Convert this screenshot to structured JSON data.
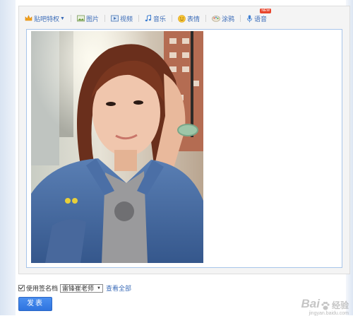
{
  "toolbar": {
    "items": [
      {
        "label": "贴吧特权",
        "icon": "crown-icon",
        "dropdown": true
      },
      {
        "label": "图片",
        "icon": "picture-icon"
      },
      {
        "label": "视频",
        "icon": "video-icon"
      },
      {
        "label": "音乐",
        "icon": "music-icon"
      },
      {
        "label": "表情",
        "icon": "emoji-icon"
      },
      {
        "label": "涂鸦",
        "icon": "doodle-icon"
      },
      {
        "label": "语音",
        "icon": "microphone-icon",
        "badge": "NEW"
      }
    ]
  },
  "signature": {
    "checkbox_label": "使用签名档",
    "checked": true,
    "selected": "雷锋崔老师",
    "view_all": "查看全部"
  },
  "submit": {
    "label": "发表"
  },
  "watermark": {
    "brand": "Bai",
    "suffix": "经验",
    "url": "jingyan.baidu.com"
  },
  "colors": {
    "link": "#3d6db8",
    "button": "#3179e3",
    "editor_border": "#a8c5ea"
  }
}
